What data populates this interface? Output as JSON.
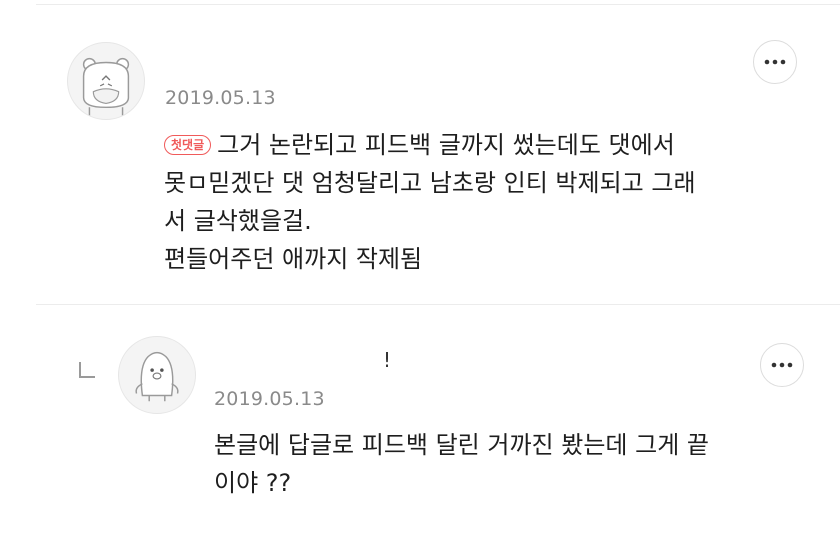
{
  "comments": [
    {
      "date": "2019.05.13",
      "badge": "첫댓글",
      "lines": [
        "그거 논란되고 피드백 글까지 썼는데도 댓에서",
        "못ㅁ믿겠단 댓 엄청달리고 남초랑 인티 박제되고 그래",
        "서 글삭했을걸.",
        "편들어주던 애까지 작제됨"
      ]
    },
    {
      "name_mark": "!",
      "date": "2019.05.13",
      "lines": [
        "본글에 답글로 피드백 달린 거까진 봤는데 그게 끝",
        "이야 ??"
      ]
    }
  ],
  "icons": {
    "more": "more-horizontal-icon",
    "reply": "reply-arrow-icon",
    "avatar1": "hamster-avatar",
    "avatar2": "penguin-avatar"
  },
  "colors": {
    "badge": "#f05a5a",
    "date": "#8a8a8a",
    "divider": "#ececec"
  }
}
